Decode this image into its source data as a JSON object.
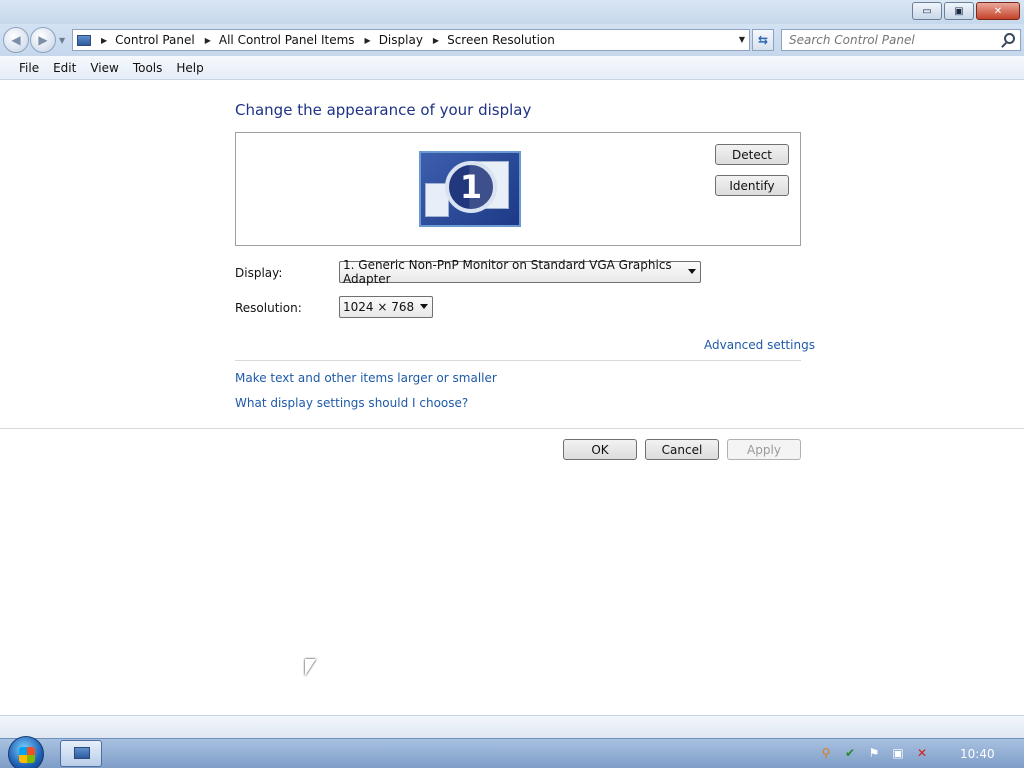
{
  "window": {
    "minimize": "▭",
    "maximize": "▣",
    "close": "✕"
  },
  "address": {
    "crumbs": [
      "Control Panel",
      "All Control Panel Items",
      "Display",
      "Screen Resolution"
    ],
    "search_placeholder": "Search Control Panel"
  },
  "menu": [
    "File",
    "Edit",
    "View",
    "Tools",
    "Help"
  ],
  "main": {
    "heading": "Change the appearance of your display",
    "monitor_number": "1",
    "detect_label": "Detect",
    "identify_label": "Identify",
    "display_label": "Display:",
    "display_value": "1. Generic Non-PnP Monitor on Standard VGA Graphics Adapter",
    "resolution_label": "Resolution:",
    "resolution_value": "1024 × 768",
    "advanced_link": "Advanced settings",
    "text_size_link": "Make text and other items larger or smaller",
    "help_link": "What display settings should I choose?",
    "ok_label": "OK",
    "cancel_label": "Cancel",
    "apply_label": "Apply"
  },
  "taskbar": {
    "clock": "10:40"
  }
}
